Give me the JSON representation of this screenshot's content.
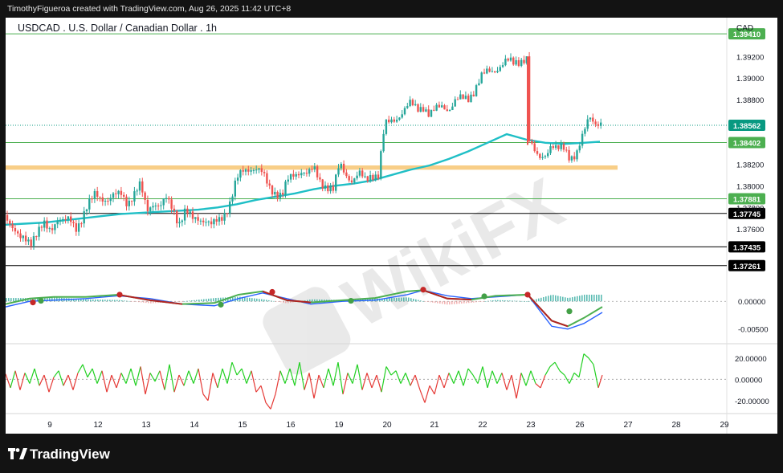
{
  "header": {
    "caption": "TimothyFigueroa created with TradingView.com, Aug 26, 2025 11:42 UTC+8"
  },
  "footer": {
    "brand": "TradingView",
    "logo_icon": "tradingview-logo-icon"
  },
  "watermark": {
    "text": "WikiFX",
    "logo_icon": "wikifx-logo-icon"
  },
  "chart_data": {
    "type": "candlestick",
    "title": "USDCAD . U.S. Dollar / Canadian Dollar . 1h",
    "currency": "CAD",
    "x_tick_labels": [
      "9",
      "12",
      "13",
      "14",
      "15",
      "16",
      "19",
      "20",
      "21",
      "22",
      "23",
      "26",
      "27",
      "28",
      "29"
    ],
    "price_axis": {
      "ylim": [
        1.3714,
        1.3956
      ],
      "ticks": [
        1.376,
        1.378,
        1.38,
        1.382,
        1.388,
        1.39,
        1.392
      ],
      "tick_labels": [
        "1.37600",
        "1.37800",
        "1.38000",
        "1.38200",
        "1.38800",
        "1.39000",
        "1.39200"
      ]
    },
    "horizontal_levels": [
      {
        "value": 1.3941,
        "label": "1.39410",
        "color": "#4caf50"
      },
      {
        "value": 1.38402,
        "label": "1.38402",
        "color": "#4caf50"
      },
      {
        "value": 1.37881,
        "label": "1.37881",
        "color": "#4caf50"
      },
      {
        "value": 1.37745,
        "label": "1.37745",
        "color": "#000000"
      },
      {
        "value": 1.37435,
        "label": "1.37435",
        "color": "#000000"
      },
      {
        "value": 1.37261,
        "label": "1.37261",
        "color": "#000000"
      }
    ],
    "current_price": {
      "value": 1.38562,
      "label": "1.38562",
      "color": "#089981"
    },
    "support_zone": {
      "from": 1.3815,
      "to": 1.3819,
      "color": "#f7c97a"
    },
    "moving_average": {
      "color": "#1fbfc6",
      "points": [
        [
          0,
          1.3764
        ],
        [
          24,
          1.3765
        ],
        [
          48,
          1.3766
        ],
        [
          72,
          1.3768
        ],
        [
          96,
          1.377
        ],
        [
          120,
          1.3772
        ],
        [
          144,
          1.3774
        ],
        [
          168,
          1.3775
        ],
        [
          192,
          1.3776
        ],
        [
          216,
          1.3777
        ],
        [
          240,
          1.3778
        ],
        [
          264,
          1.378
        ],
        [
          288,
          1.3783
        ],
        [
          312,
          1.3787
        ],
        [
          336,
          1.379
        ],
        [
          360,
          1.3793
        ],
        [
          384,
          1.3797
        ],
        [
          408,
          1.38
        ],
        [
          432,
          1.3802
        ],
        [
          456,
          1.3805
        ],
        [
          480,
          1.381
        ],
        [
          504,
          1.3815
        ],
        [
          528,
          1.3819
        ],
        [
          552,
          1.3825
        ],
        [
          576,
          1.3832
        ],
        [
          600,
          1.384
        ],
        [
          624,
          1.3848
        ],
        [
          648,
          1.3843
        ],
        [
          672,
          1.384
        ],
        [
          696,
          1.3839
        ],
        [
          720,
          1.384
        ],
        [
          740,
          1.3841
        ]
      ]
    },
    "price_path": [
      [
        0,
        1.3773
      ],
      [
        8,
        1.3758
      ],
      [
        16,
        1.3752
      ],
      [
        24,
        1.3755
      ],
      [
        32,
        1.3748
      ],
      [
        40,
        1.3754
      ],
      [
        48,
        1.3765
      ],
      [
        56,
        1.3762
      ],
      [
        64,
        1.3768
      ],
      [
        72,
        1.3765
      ],
      [
        80,
        1.377
      ],
      [
        88,
        1.3763
      ],
      [
        96,
        1.377
      ],
      [
        104,
        1.3782
      ],
      [
        112,
        1.3795
      ],
      [
        120,
        1.379
      ],
      [
        128,
        1.3785
      ],
      [
        136,
        1.379
      ],
      [
        144,
        1.3795
      ],
      [
        152,
        1.3785
      ],
      [
        160,
        1.379
      ],
      [
        168,
        1.38
      ],
      [
        176,
        1.378
      ],
      [
        184,
        1.3785
      ],
      [
        192,
        1.3778
      ],
      [
        200,
        1.3788
      ],
      [
        208,
        1.3782
      ],
      [
        216,
        1.3765
      ],
      [
        224,
        1.3775
      ],
      [
        232,
        1.377
      ],
      [
        240,
        1.3772
      ],
      [
        248,
        1.3768
      ],
      [
        256,
        1.3762
      ],
      [
        264,
        1.3768
      ],
      [
        272,
        1.3775
      ],
      [
        280,
        1.3785
      ],
      [
        288,
        1.3805
      ],
      [
        296,
        1.3815
      ],
      [
        304,
        1.3818
      ],
      [
        312,
        1.3815
      ],
      [
        320,
        1.381
      ],
      [
        328,
        1.38
      ],
      [
        336,
        1.3795
      ],
      [
        344,
        1.379
      ],
      [
        352,
        1.3805
      ],
      [
        360,
        1.3812
      ],
      [
        368,
        1.3815
      ],
      [
        376,
        1.381
      ],
      [
        384,
        1.3815
      ],
      [
        392,
        1.3805
      ],
      [
        400,
        1.38
      ],
      [
        408,
        1.3795
      ],
      [
        416,
        1.382
      ],
      [
        424,
        1.3812
      ],
      [
        432,
        1.3805
      ],
      [
        440,
        1.381
      ],
      [
        448,
        1.3805
      ],
      [
        456,
        1.3812
      ],
      [
        464,
        1.381
      ],
      [
        472,
        1.3855
      ],
      [
        480,
        1.386
      ],
      [
        488,
        1.3865
      ],
      [
        496,
        1.387
      ],
      [
        504,
        1.3875
      ],
      [
        512,
        1.3872
      ],
      [
        520,
        1.3875
      ],
      [
        528,
        1.3865
      ],
      [
        536,
        1.387
      ],
      [
        544,
        1.3875
      ],
      [
        552,
        1.3872
      ],
      [
        560,
        1.3878
      ],
      [
        568,
        1.388
      ],
      [
        576,
        1.3882
      ],
      [
        584,
        1.389
      ],
      [
        592,
        1.39
      ],
      [
        600,
        1.3905
      ],
      [
        608,
        1.3908
      ],
      [
        616,
        1.3912
      ],
      [
        624,
        1.3915
      ],
      [
        632,
        1.3913
      ],
      [
        640,
        1.3917
      ],
      [
        648,
        1.392
      ],
      [
        650,
        1.3917
      ],
      [
        651,
        1.3845
      ],
      [
        655,
        1.3835
      ],
      [
        663,
        1.3825
      ],
      [
        671,
        1.383
      ],
      [
        679,
        1.3838
      ],
      [
        687,
        1.3832
      ],
      [
        695,
        1.3835
      ],
      [
        703,
        1.3828
      ],
      [
        711,
        1.383
      ],
      [
        719,
        1.3845
      ],
      [
        727,
        1.3865
      ],
      [
        735,
        1.386
      ],
      [
        743,
        1.3858
      ]
    ]
  },
  "oscillator1": {
    "ticks": [
      0.0,
      -0.005
    ],
    "tick_labels": [
      "0.00000",
      "-0.00500"
    ],
    "ylim": [
      -0.0075,
      0.0038
    ],
    "line_a_color": "#2962ff",
    "line_b_color": "#4caf50",
    "line_b_down_color": "#b22222",
    "line_a": [
      [
        0,
        -0.001
      ],
      [
        30,
        0.0
      ],
      [
        60,
        0.0002
      ],
      [
        100,
        0.0005
      ],
      [
        140,
        0.001
      ],
      [
        180,
        0.0005
      ],
      [
        220,
        -0.0005
      ],
      [
        260,
        -0.0008
      ],
      [
        290,
        0.0005
      ],
      [
        320,
        0.0015
      ],
      [
        350,
        0.0005
      ],
      [
        380,
        -0.0005
      ],
      [
        420,
        0.0
      ],
      [
        460,
        0.0002
      ],
      [
        500,
        0.0012
      ],
      [
        520,
        0.002
      ],
      [
        550,
        0.001
      ],
      [
        580,
        0.0005
      ],
      [
        610,
        0.0008
      ],
      [
        650,
        0.0012
      ],
      [
        680,
        -0.0045
      ],
      [
        700,
        -0.005
      ],
      [
        720,
        -0.004
      ],
      [
        743,
        -0.002
      ]
    ],
    "line_b": [
      [
        0,
        -0.0005
      ],
      [
        30,
        0.0005
      ],
      [
        60,
        0.0008
      ],
      [
        100,
        0.0008
      ],
      [
        140,
        0.0012
      ],
      [
        180,
        0.0002
      ],
      [
        220,
        -0.0005
      ],
      [
        260,
        -0.0003
      ],
      [
        290,
        0.0012
      ],
      [
        320,
        0.0018
      ],
      [
        350,
        0.0002
      ],
      [
        380,
        -0.0002
      ],
      [
        420,
        0.0002
      ],
      [
        460,
        0.0006
      ],
      [
        500,
        0.0018
      ],
      [
        520,
        0.002
      ],
      [
        550,
        0.0005
      ],
      [
        580,
        0.0003
      ],
      [
        610,
        0.001
      ],
      [
        650,
        0.0012
      ],
      [
        680,
        -0.0035
      ],
      [
        700,
        -0.0045
      ],
      [
        720,
        -0.003
      ],
      [
        743,
        -0.001
      ]
    ],
    "signal_dots": [
      {
        "t": 34,
        "v": -0.0002,
        "color": "#c62828"
      },
      {
        "t": 44,
        "v": 0.0001,
        "color": "#43a047"
      },
      {
        "t": 142,
        "v": 0.0012,
        "color": "#c62828"
      },
      {
        "t": 268,
        "v": -0.0006,
        "color": "#43a047"
      },
      {
        "t": 332,
        "v": 0.0017,
        "color": "#c62828"
      },
      {
        "t": 430,
        "v": 0.0001,
        "color": "#43a047"
      },
      {
        "t": 520,
        "v": 0.0021,
        "color": "#c62828"
      },
      {
        "t": 596,
        "v": 0.0009,
        "color": "#43a047"
      },
      {
        "t": 650,
        "v": 0.0012,
        "color": "#c62828"
      },
      {
        "t": 702,
        "v": -0.0018,
        "color": "#43a047"
      }
    ]
  },
  "oscillator2": {
    "ticks": [
      20.0,
      0.0,
      -20.0
    ],
    "tick_labels": [
      "20.00000",
      "0.00000",
      "-20.00000"
    ],
    "ylim": [
      -30,
      32
    ],
    "up_color": "#22d022",
    "down_color": "#e53935",
    "values": [
      [
        0,
        5
      ],
      [
        6,
        -8
      ],
      [
        12,
        8
      ],
      [
        18,
        -10
      ],
      [
        24,
        6
      ],
      [
        30,
        -4
      ],
      [
        36,
        10
      ],
      [
        42,
        -6
      ],
      [
        48,
        4
      ],
      [
        54,
        -12
      ],
      [
        60,
        2
      ],
      [
        66,
        8
      ],
      [
        72,
        -6
      ],
      [
        78,
        4
      ],
      [
        84,
        -10
      ],
      [
        90,
        6
      ],
      [
        96,
        14
      ],
      [
        102,
        2
      ],
      [
        108,
        10
      ],
      [
        114,
        -4
      ],
      [
        120,
        8
      ],
      [
        126,
        -12
      ],
      [
        132,
        4
      ],
      [
        138,
        -8
      ],
      [
        144,
        6
      ],
      [
        150,
        -4
      ],
      [
        156,
        10
      ],
      [
        162,
        -6
      ],
      [
        168,
        12
      ],
      [
        174,
        -14
      ],
      [
        180,
        6
      ],
      [
        186,
        -2
      ],
      [
        192,
        8
      ],
      [
        198,
        -10
      ],
      [
        204,
        14
      ],
      [
        210,
        -12
      ],
      [
        216,
        4
      ],
      [
        222,
        -6
      ],
      [
        228,
        8
      ],
      [
        234,
        -4
      ],
      [
        240,
        10
      ],
      [
        246,
        -14
      ],
      [
        252,
        -20
      ],
      [
        258,
        6
      ],
      [
        264,
        -8
      ],
      [
        270,
        10
      ],
      [
        276,
        -4
      ],
      [
        282,
        16
      ],
      [
        288,
        4
      ],
      [
        294,
        10
      ],
      [
        300,
        -4
      ],
      [
        306,
        8
      ],
      [
        312,
        -12
      ],
      [
        318,
        -6
      ],
      [
        324,
        -22
      ],
      [
        330,
        -28
      ],
      [
        336,
        -14
      ],
      [
        342,
        8
      ],
      [
        348,
        -4
      ],
      [
        354,
        10
      ],
      [
        360,
        -6
      ],
      [
        366,
        16
      ],
      [
        372,
        -10
      ],
      [
        378,
        6
      ],
      [
        384,
        -18
      ],
      [
        390,
        4
      ],
      [
        396,
        -8
      ],
      [
        402,
        10
      ],
      [
        408,
        -6
      ],
      [
        414,
        16
      ],
      [
        420,
        -14
      ],
      [
        426,
        6
      ],
      [
        432,
        -4
      ],
      [
        438,
        14
      ],
      [
        444,
        -10
      ],
      [
        450,
        6
      ],
      [
        456,
        -8
      ],
      [
        462,
        4
      ],
      [
        468,
        -12
      ],
      [
        474,
        12
      ],
      [
        480,
        4
      ],
      [
        486,
        8
      ],
      [
        492,
        -4
      ],
      [
        498,
        6
      ],
      [
        504,
        -6
      ],
      [
        510,
        4
      ],
      [
        516,
        -10
      ],
      [
        522,
        -22
      ],
      [
        528,
        -6
      ],
      [
        534,
        -14
      ],
      [
        540,
        4
      ],
      [
        546,
        -8
      ],
      [
        552,
        6
      ],
      [
        558,
        -4
      ],
      [
        564,
        8
      ],
      [
        570,
        -6
      ],
      [
        576,
        10
      ],
      [
        582,
        4
      ],
      [
        588,
        -4
      ],
      [
        594,
        12
      ],
      [
        600,
        -8
      ],
      [
        606,
        8
      ],
      [
        612,
        -4
      ],
      [
        618,
        6
      ],
      [
        624,
        -10
      ],
      [
        630,
        4
      ],
      [
        636,
        -18
      ],
      [
        642,
        6
      ],
      [
        648,
        -6
      ],
      [
        654,
        8
      ],
      [
        660,
        -4
      ],
      [
        666,
        -8
      ],
      [
        672,
        4
      ],
      [
        678,
        12
      ],
      [
        684,
        16
      ],
      [
        690,
        8
      ],
      [
        696,
        4
      ],
      [
        702,
        -4
      ],
      [
        708,
        6
      ],
      [
        714,
        2
      ],
      [
        720,
        24
      ],
      [
        726,
        20
      ],
      [
        732,
        14
      ],
      [
        738,
        -8
      ],
      [
        743,
        4
      ]
    ]
  }
}
